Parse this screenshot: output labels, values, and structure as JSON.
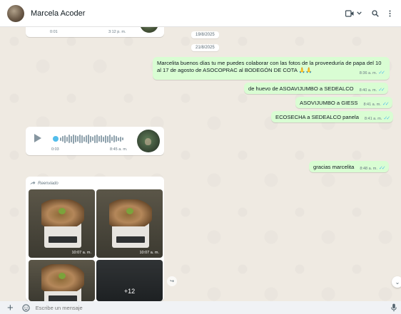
{
  "header": {
    "contact_name": "Marcela Acoder"
  },
  "messages": {
    "top_audio": {
      "duration": "0:01",
      "time": "3:12 p. m."
    },
    "date_1": "19/8/2025",
    "date_2": "21/8/2025",
    "out_1": {
      "text": "Marcelita buenos días tu me puedes colaborar con las fotos de la proveeduría de papa del 10 al 17 de agosto de ASOCOPRAC al BODEGÓN DE COTA 🙏🙏",
      "time": "8:36 a. m."
    },
    "out_2": {
      "text": "de huevo de ASOAVIJUMBO  a SEDEALCO",
      "time": "8:40 a. m."
    },
    "out_3": {
      "text": "ASOVIJUMBO a GIESS",
      "time": "8:41 a. m."
    },
    "out_4": {
      "text": "ECOSECHA a SEDEALCO panela",
      "time": "8:41 a. m."
    },
    "audio": {
      "duration": "0:03",
      "time": "8:45 a. m."
    },
    "out_5": {
      "text": "gracias marcelita",
      "time": "8:48 a. m."
    },
    "album": {
      "forwarded_label": "Reenviado",
      "photo_1_time": "10:07 a. m.",
      "photo_2_time": "10:07 a. m.",
      "more_count": "+12"
    }
  },
  "composer": {
    "placeholder": "Escribe un mensaje"
  },
  "colors": {
    "outgoing_bubble": "#d9fdd3",
    "incoming_bubble": "#ffffff",
    "read_ticks": "#53bdeb",
    "chat_background": "#efeae2"
  },
  "icons": [
    "video-call-icon",
    "chevron-down-icon",
    "search-icon",
    "menu-icon",
    "play-icon",
    "forward-icon",
    "share-icon",
    "scroll-down-icon",
    "plus-icon",
    "emoji-icon",
    "mic-icon"
  ]
}
